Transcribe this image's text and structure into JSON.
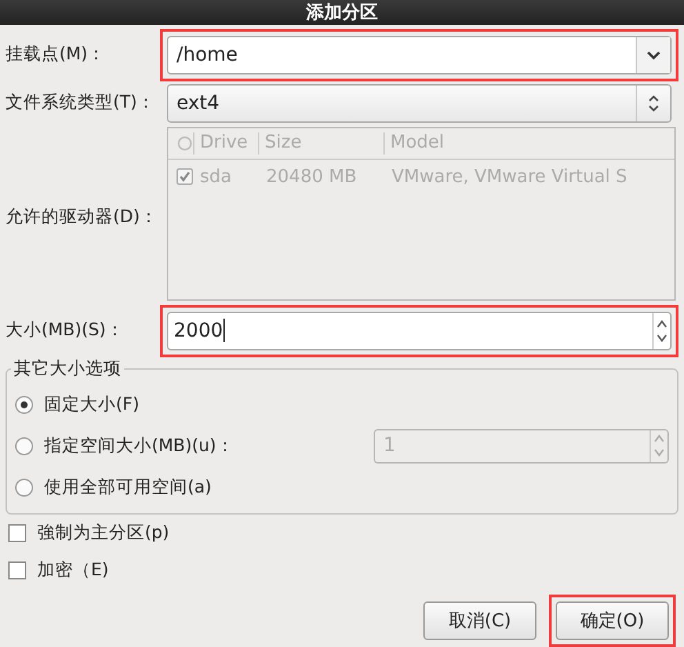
{
  "window": {
    "title": "添加分区"
  },
  "mount_point": {
    "label": "挂载点(M)：",
    "value": "/home",
    "highlighted": true
  },
  "filesystem": {
    "label": "文件系统类型(T)：",
    "value": "ext4"
  },
  "drives": {
    "label": "允许的驱动器(D)：",
    "columns": [
      "Drive",
      "Size",
      "Model"
    ],
    "rows": [
      {
        "checked": true,
        "disabled": true,
        "drive": "sda",
        "size": "20480 MB",
        "model": "VMware, VMware Virtual S"
      }
    ]
  },
  "size": {
    "label": "大小(MB)(S)：",
    "value": "2000",
    "highlighted": true
  },
  "size_options": {
    "title": "其它大小选项",
    "options": [
      {
        "label": "固定大小(F)",
        "selected": true,
        "kind": "plain"
      },
      {
        "label": "指定空间大小(MB)(u)：",
        "selected": false,
        "kind": "spin",
        "value": "1",
        "disabled": true
      },
      {
        "label": "使用全部可用空间(a)",
        "selected": false,
        "kind": "plain"
      }
    ]
  },
  "checkboxes": [
    {
      "label": "強制为主分区(p)",
      "checked": false
    },
    {
      "label": "加密（E)",
      "checked": false
    }
  ],
  "buttons": [
    {
      "label": "取消(C)",
      "highlighted": false
    },
    {
      "label": "确定(O)",
      "highlighted": true
    }
  ]
}
